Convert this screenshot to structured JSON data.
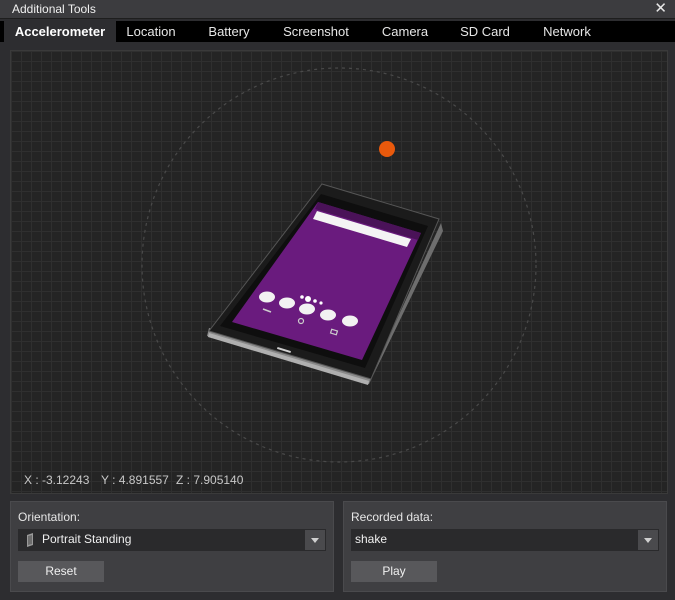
{
  "window": {
    "title": "Additional Tools",
    "close_glyph": "✕"
  },
  "tabs": [
    {
      "label": "Accelerometer",
      "active": true
    },
    {
      "label": "Location"
    },
    {
      "label": "Battery"
    },
    {
      "label": "Screenshot"
    },
    {
      "label": "Camera"
    },
    {
      "label": "SD Card"
    },
    {
      "label": "Network"
    }
  ],
  "readout": {
    "x": "X : -3.12243",
    "y": "Y : 4.891557",
    "z": "Z : 7.905140"
  },
  "orientation": {
    "label": "Orientation:",
    "value": "Portrait Standing",
    "icon": "phone-icon",
    "reset_label": "Reset"
  },
  "recorded": {
    "label": "Recorded data:",
    "value": "shake",
    "play_label": "Play"
  },
  "colors": {
    "accent_dot": "#e8590c",
    "screen": "#6a1b7e",
    "tab_active_bg": "#2d2d30",
    "tab_bar_bg": "#000000"
  }
}
